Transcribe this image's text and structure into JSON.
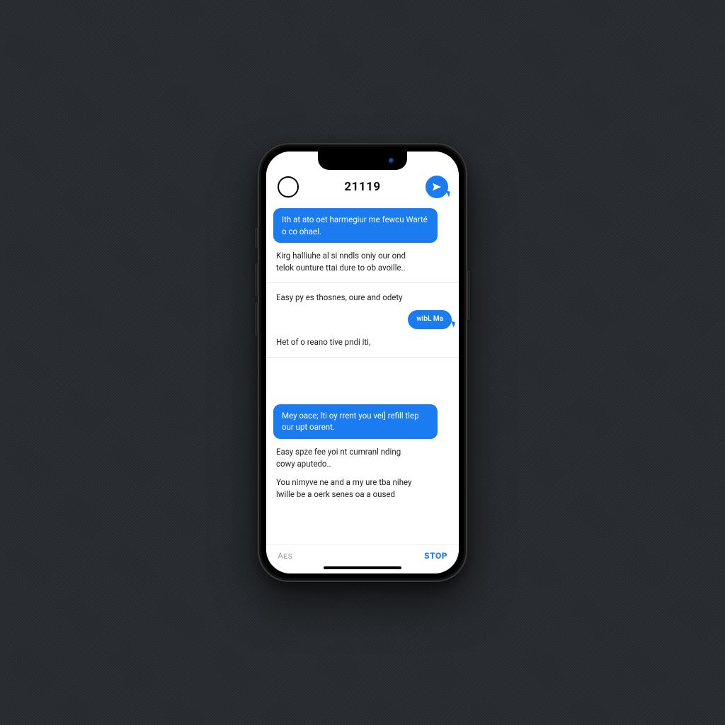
{
  "colors": {
    "accent": "#1a7cf0",
    "bg": "#ffffff",
    "text": "#111111"
  },
  "header": {
    "title": "21119",
    "back_icon": "circle-outline-icon",
    "action_icon": "send-icon"
  },
  "messages": [
    {
      "kind": "sent",
      "text": "Ith at ato oet harmegiur me fewcu Warté o co ohael."
    },
    {
      "kind": "recv",
      "text": "Kirg halliuhe al si nndls oniy our ond telok ounture ttai dure to ob avoille.."
    },
    {
      "kind": "divider"
    },
    {
      "kind": "recv",
      "text": "Easy py es thosnes, oure and odety"
    },
    {
      "kind": "sent-small",
      "text": "wibL Ma"
    },
    {
      "kind": "recv",
      "text": "Het of o reano tive pndi iti,"
    },
    {
      "kind": "divider"
    },
    {
      "kind": "gap"
    },
    {
      "kind": "sent",
      "text": "Mey oace; lti oy rrent you vei] refill tlep our upt oarent."
    },
    {
      "kind": "recv",
      "text": "Easy spze fee yoi nt cumranl nding cowy aputedo.."
    },
    {
      "kind": "recv",
      "text": "You nimyve ne and a my ure tba nihey lwille be a oerk senes oa a oused"
    }
  ],
  "footer": {
    "left": "Aes",
    "right": "STOP"
  }
}
